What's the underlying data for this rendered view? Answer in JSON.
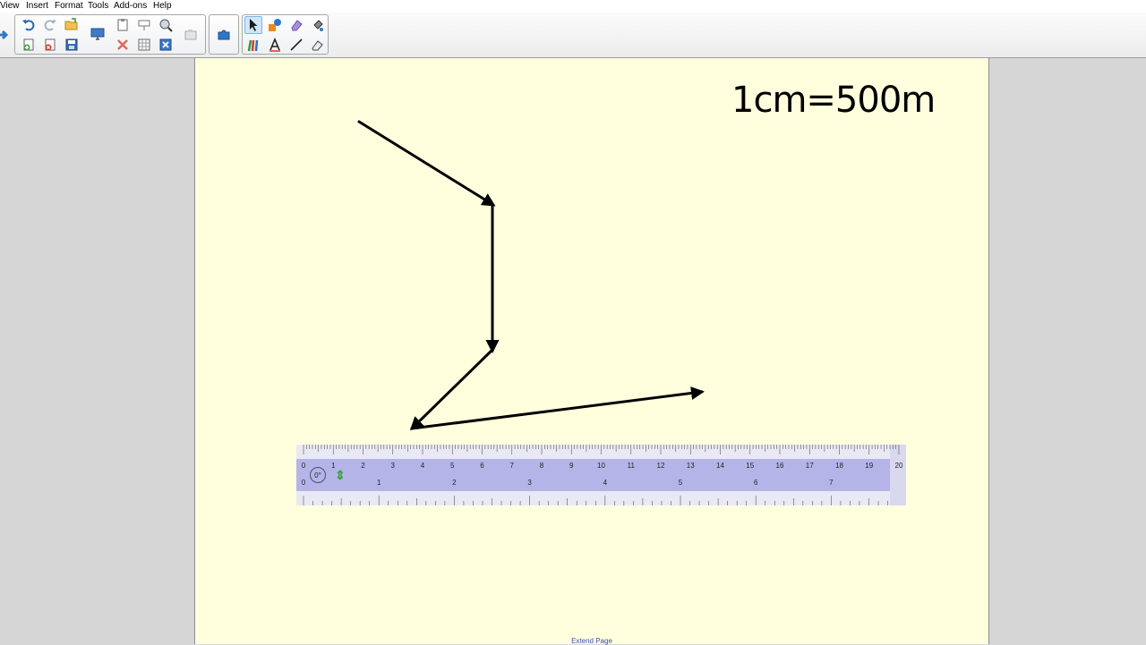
{
  "menu": [
    "View",
    "Insert",
    "Format",
    "Tools",
    "Add-ons",
    "Help"
  ],
  "page": {
    "scale_text": "1cm=500m",
    "extend_label": "Extend Page",
    "rotation_label": "0°"
  },
  "ruler": {
    "top_numbers": [
      "0",
      "1",
      "2",
      "3",
      "4",
      "5",
      "6",
      "7",
      "8",
      "9",
      "10",
      "11",
      "12",
      "13",
      "14",
      "15",
      "16",
      "17",
      "18",
      "19",
      "20"
    ],
    "bottom_numbers": [
      "0",
      "1",
      "2",
      "3",
      "4",
      "5",
      "6",
      "7"
    ]
  },
  "colors": {
    "page_background": "#ffffde",
    "ruler_fill": "#9694ee",
    "pen_line": "#000000",
    "active_tool": "#cfe6fb"
  },
  "tools": [
    {
      "name": "navigate-arrow-icon"
    },
    {
      "name": "undo-icon"
    },
    {
      "name": "redo-icon"
    },
    {
      "name": "open-folder-icon"
    },
    {
      "name": "new-page-icon"
    },
    {
      "name": "delete-page-icon"
    },
    {
      "name": "save-icon"
    },
    {
      "name": "display-icon"
    },
    {
      "name": "paste-icon"
    },
    {
      "name": "screen-shade-icon"
    },
    {
      "name": "magic-ink-icon"
    },
    {
      "name": "cut-delete-icon"
    },
    {
      "name": "table-icon"
    },
    {
      "name": "close-box-icon"
    },
    {
      "name": "capture-icon"
    },
    {
      "name": "add-ons-puzzle-icon"
    },
    {
      "name": "select-pointer-icon"
    },
    {
      "name": "shapes-icon"
    },
    {
      "name": "eraser-icon"
    },
    {
      "name": "fill-icon"
    },
    {
      "name": "pens-icon"
    },
    {
      "name": "text-icon"
    },
    {
      "name": "line-icon"
    },
    {
      "name": "magic-eraser-icon"
    }
  ]
}
